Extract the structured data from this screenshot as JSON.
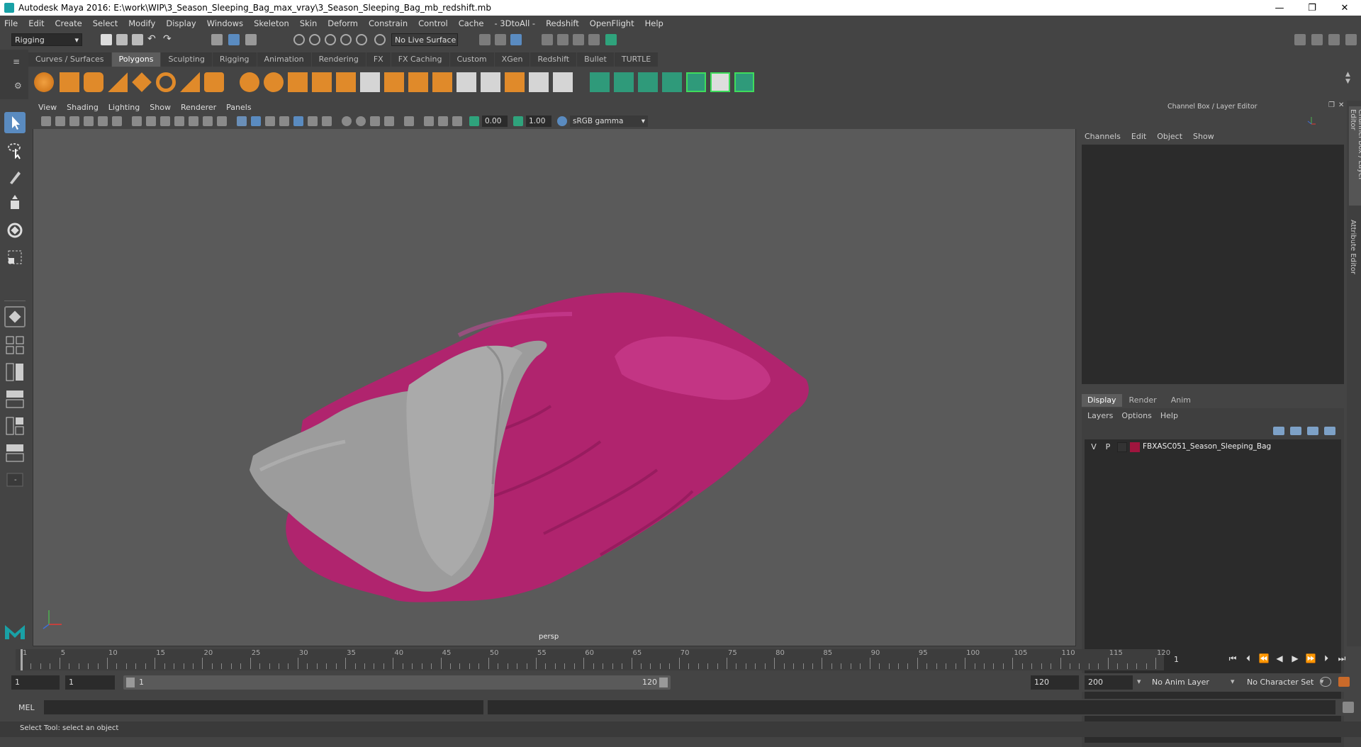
{
  "title": "Autodesk Maya 2016: E:\\work\\WIP\\3_Season_Sleeping_Bag_max_vray\\3_Season_Sleeping_Bag_mb_redshift.mb",
  "window_controls": [
    "—",
    "❐",
    "✕"
  ],
  "menu": [
    "File",
    "Edit",
    "Create",
    "Select",
    "Modify",
    "Display",
    "Windows",
    "Skeleton",
    "Skin",
    "Deform",
    "Constrain",
    "Control",
    "Cache",
    "- 3DtoAll -",
    "Redshift",
    "OpenFlight",
    "Help"
  ],
  "status": {
    "mode": "Rigging",
    "live_surface": "No Live Surface"
  },
  "shelf_tabs": [
    "Curves / Surfaces",
    "Polygons",
    "Sculpting",
    "Rigging",
    "Animation",
    "Rendering",
    "FX",
    "FX Caching",
    "Custom",
    "XGen",
    "Redshift",
    "Bullet",
    "TURTLE"
  ],
  "active_shelf": "Polygons",
  "viewport": {
    "menu": [
      "View",
      "Shading",
      "Lighting",
      "Show",
      "Renderer",
      "Panels"
    ],
    "exposure": "0.00",
    "gamma": "1.00",
    "color_space": "sRGB gamma",
    "camera": "persp"
  },
  "channel_box": {
    "title": "Channel Box / Layer Editor",
    "menu": [
      "Channels",
      "Edit",
      "Object",
      "Show"
    ],
    "layer_tabs": [
      "Display",
      "Render",
      "Anim"
    ],
    "active_layer_tab": "Display",
    "layer_menu": [
      "Layers",
      "Options",
      "Help"
    ],
    "layers": [
      {
        "v": "V",
        "p": "P",
        "color": "#a0153e",
        "name": "FBXASC051_Season_Sleeping_Bag"
      }
    ]
  },
  "side_tabs": [
    "Channel Box / Layer Editor",
    "Attribute Editor"
  ],
  "timeline": {
    "ticks": [
      "1",
      "5",
      "10",
      "15",
      "20",
      "25",
      "30",
      "35",
      "40",
      "45",
      "50",
      "55",
      "60",
      "65",
      "70",
      "75",
      "80",
      "85",
      "90",
      "95",
      "100",
      "105",
      "110",
      "115",
      "120"
    ],
    "current_frame": "1",
    "range_start": "1",
    "playback_start": "1",
    "slider_start": "1",
    "slider_end": "120",
    "playback_end": "120",
    "range_end": "200",
    "anim_layer": "No Anim Layer",
    "character_set": "No Character Set"
  },
  "command_line": {
    "label": "MEL"
  },
  "help_line": "Select Tool: select an object"
}
